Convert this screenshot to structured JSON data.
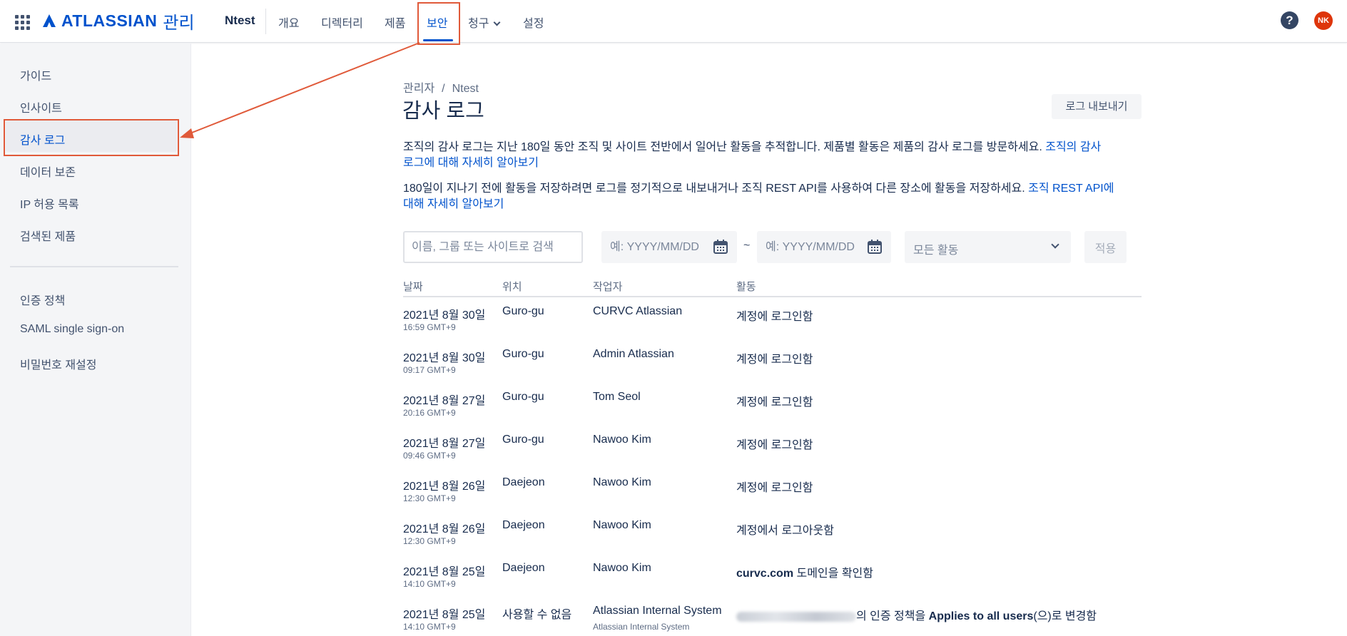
{
  "topnav": {
    "logo_text": "ATLASSIAN",
    "logo_sub": "관리",
    "org": "Ntest",
    "items": [
      {
        "label": "개요"
      },
      {
        "label": "디렉터리"
      },
      {
        "label": "제품"
      },
      {
        "label": "보안"
      },
      {
        "label": "청구"
      },
      {
        "label": "설정"
      }
    ],
    "active": "보안",
    "help_icon": "help-icon",
    "avatar_initials": "NK"
  },
  "sidebar": {
    "items": [
      {
        "label": "가이드"
      },
      {
        "label": "인사이트"
      },
      {
        "label": "감사 로그"
      },
      {
        "label": "데이터 보존"
      },
      {
        "label": "IP 허용 목록"
      },
      {
        "label": "검색된 제품"
      },
      {
        "label": "인증 정책"
      },
      {
        "label": "SAML single sign-on"
      },
      {
        "label": "비밀번호 재설정"
      }
    ],
    "active": "감사 로그"
  },
  "main": {
    "breadcrumb": [
      "관리자",
      "/",
      "Ntest"
    ],
    "title": "감사 로그",
    "export_label": "로그 내보내기",
    "para1_text": "조직의 감사 로그는 지난 180일 동안 조직 및 사이트 전반에서 일어난 활동을 추적합니다. 제품별 활동은 제품의 감사 로그를 방문하세요.",
    "para1_link_a": "조직의 감사",
    "para1_link_b": "로그에 대해 자세히 알아보기",
    "para2_text": "180일이 지나기 전에 활동을 저장하려면 로그를 정기적으로 내보내거나 조직 REST API를 사용하여 다른 장소에 활동을 저장하세요.",
    "para2_link_a": "조직 REST API에",
    "para2_link_b": "대해 자세히 알아보기",
    "filters": {
      "search_placeholder": "이름, 그룹 또는 사이트로 검색",
      "from_placeholder": "예: YYYY/MM/DD",
      "to_placeholder": "예: YYYY/MM/DD",
      "tilde": "~",
      "activity_select": "모든 활동",
      "apply_label": "적용"
    },
    "table": {
      "headers": [
        "날짜",
        "위치",
        "작업자",
        "활동"
      ],
      "rows": [
        {
          "date": "2021년 8월 30일",
          "time": "16:59 GMT+9",
          "location": "Guro-gu",
          "actor": "CURVC Atlassian",
          "activity": "계정에 로그인함"
        },
        {
          "date": "2021년 8월 30일",
          "time": "09:17 GMT+9",
          "location": "Guro-gu",
          "actor": "Admin Atlassian",
          "activity": "계정에 로그인함"
        },
        {
          "date": "2021년 8월 27일",
          "time": "20:16 GMT+9",
          "location": "Guro-gu",
          "actor": "Tom Seol",
          "activity": "계정에 로그인함"
        },
        {
          "date": "2021년 8월 27일",
          "time": "09:46 GMT+9",
          "location": "Guro-gu",
          "actor": "Nawoo Kim",
          "activity": "계정에 로그인함"
        },
        {
          "date": "2021년 8월 26일",
          "time": "12:30 GMT+9",
          "location": "Daejeon",
          "actor": "Nawoo Kim",
          "activity": "계정에 로그인함"
        },
        {
          "date": "2021년 8월 26일",
          "time": "12:30 GMT+9",
          "location": "Daejeon",
          "actor": "Nawoo Kim",
          "activity": "계정에서 로그아웃함"
        },
        {
          "date": "2021년 8월 25일",
          "time": "14:10 GMT+9",
          "location": "Daejeon",
          "actor": "Nawoo Kim",
          "activity_bold": "curvc.com",
          "activity_rest": " 도메인을 확인함"
        },
        {
          "date": "2021년 8월 25일",
          "time": "14:10 GMT+9",
          "location": "사용할 수 없음",
          "actor": "Atlassian Internal System",
          "actor_sub": "Atlassian Internal System",
          "activity_mid": "의 인증 정책을 ",
          "activity_bold": "Applies to all users",
          "activity_rest": "(으)로 변경함"
        }
      ]
    }
  },
  "colors": {
    "brand": "#0052CC",
    "annotation": "#E05A3A",
    "avatar": "#DE350B"
  }
}
